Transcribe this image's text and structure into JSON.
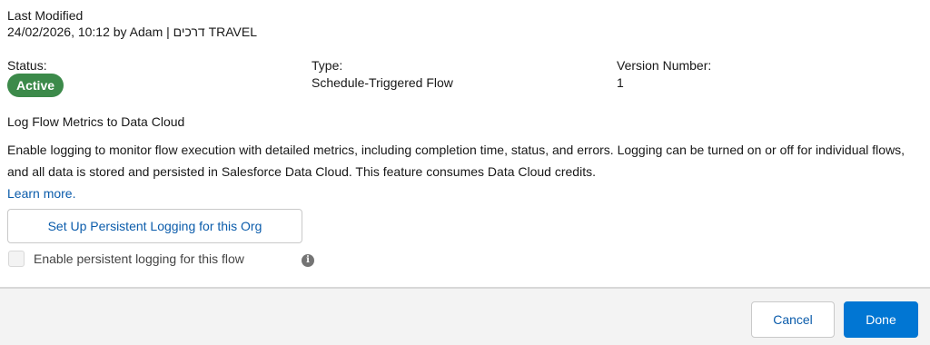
{
  "last_modified": {
    "label": "Last Modified",
    "value": "24/02/2026, 10:12 by Adam | דרכים TRAVEL"
  },
  "fields": {
    "status": {
      "label": "Status:",
      "value": "Active",
      "color": "#3c8a4a"
    },
    "type": {
      "label": "Type:",
      "value": "Schedule-Triggered Flow"
    },
    "version": {
      "label": "Version Number:",
      "value": "1"
    }
  },
  "logging": {
    "title": "Log Flow Metrics to Data Cloud",
    "description": "Enable logging to monitor flow execution with detailed metrics, including completion time, status, and errors. Logging can be turned on or off for individual flows, and all data is stored and persisted in Salesforce Data Cloud. This feature consumes Data Cloud credits.",
    "learn_more": "Learn more.",
    "setup_button": "Set Up Persistent Logging for this Org",
    "checkbox_label": "Enable persistent logging for this flow",
    "checkbox_checked": false,
    "checkbox_disabled": true,
    "info_icon": "info-icon",
    "info_glyph": "i"
  },
  "footer": {
    "cancel_label": "Cancel",
    "done_label": "Done"
  },
  "colors": {
    "link": "#0b5cab",
    "brand": "#0176d3",
    "success": "#3c8a4a"
  }
}
